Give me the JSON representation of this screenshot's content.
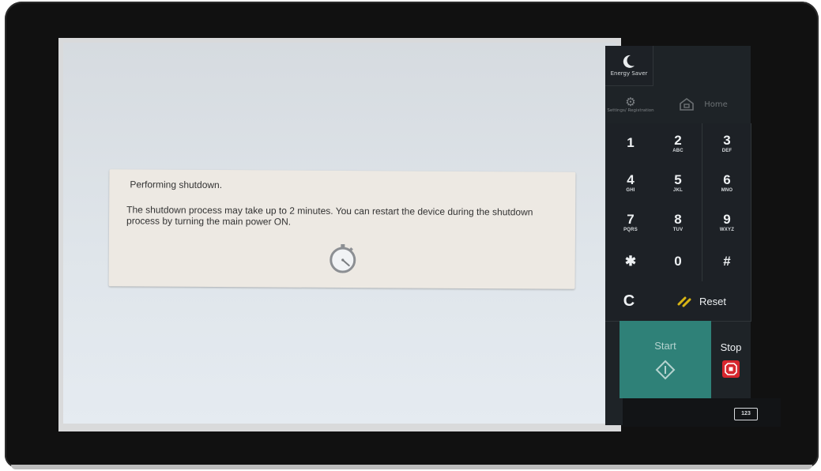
{
  "dialog": {
    "title": "Performing shutdown.",
    "message": "The shutdown process may take up to 2 minutes. You can restart the device during the shutdown process by turning the main power ON.",
    "icon": "stopwatch-icon"
  },
  "panel": {
    "energy_saver": "Energy Saver",
    "settings": "Settings/ Registration",
    "home": "Home",
    "keys": [
      {
        "num": "1",
        "sub": ""
      },
      {
        "num": "2",
        "sub": "ABC"
      },
      {
        "num": "3",
        "sub": "DEF"
      },
      {
        "num": "4",
        "sub": "GHI"
      },
      {
        "num": "5",
        "sub": "JKL"
      },
      {
        "num": "6",
        "sub": "MNO"
      },
      {
        "num": "7",
        "sub": "PQRS"
      },
      {
        "num": "8",
        "sub": "TUV"
      },
      {
        "num": "9",
        "sub": "WXYZ"
      },
      {
        "num": "✱",
        "sub": ""
      },
      {
        "num": "0",
        "sub": ""
      },
      {
        "num": "#",
        "sub": ""
      }
    ],
    "clear": "C",
    "reset": "Reset",
    "start": "Start",
    "stop": "Stop",
    "keyboard": "123"
  },
  "colors": {
    "start_bg": "#2f8178",
    "stop_red": "#d7262e",
    "reset_icon": "#d8b515"
  }
}
